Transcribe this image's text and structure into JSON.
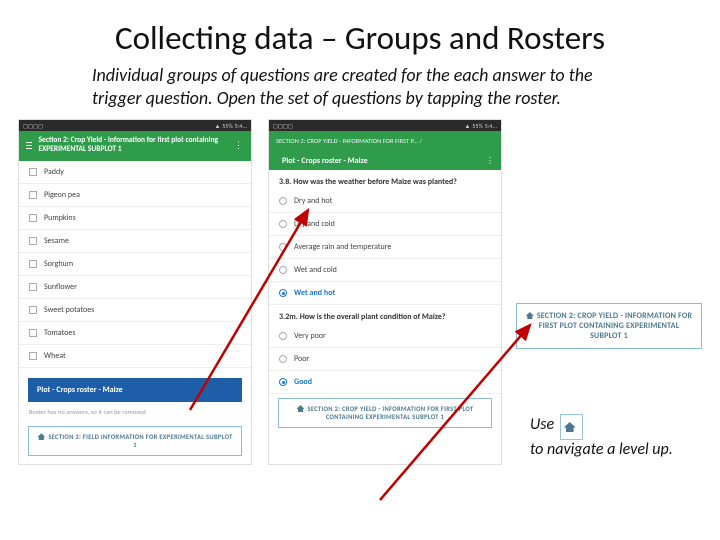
{
  "title": "Collecting data – Groups and Rosters",
  "subtitle": "Individual groups of questions are created for the each answer to the trigger question. Open the set of questions by tapping the roster.",
  "status": {
    "battery": "55%",
    "time": "5:4..."
  },
  "phone1": {
    "section": "Section 2: Crop Yield - Information for first plot containing EXPERIMENTAL SUBPLOT 1",
    "crops": [
      "Paddy",
      "Pigeon pea",
      "Pumpkins",
      "Sesame",
      "Sorghum",
      "Sunflower",
      "Sweet potatoes",
      "Tomatoes",
      "Wheat"
    ],
    "roster": "Plot - Crops roster - Maize",
    "hint": "Roster has no answers, so it can be removed",
    "nav": "SECTION 3: FIELD INFORMATION FOR EXPERIMENTAL SUBPLOT 1"
  },
  "phone2": {
    "section_top": "SECTION 2: CROP YIELD - INFORMATION FOR FIRST P... /",
    "section": "Plot - Crops roster - Maize",
    "q1": "3.8. How was the weather before Maize was planted?",
    "opts1": [
      {
        "label": "Dry and hot",
        "sel": false
      },
      {
        "label": "Dry and cold",
        "sel": false
      },
      {
        "label": "Average rain and temperature",
        "sel": false
      },
      {
        "label": "Wet and cold",
        "sel": false
      },
      {
        "label": "Wet and hot",
        "sel": true
      }
    ],
    "q2": "3.2m. How is the overall plant condition of Maize?",
    "opts2": [
      {
        "label": "Very poor",
        "sel": false
      },
      {
        "label": "Poor",
        "sel": false
      },
      {
        "label": "Good",
        "sel": true
      }
    ],
    "nav": "SECTION 2: CROP YIELD - INFORMATION FOR FIRST PLOT CONTAINING EXPERIMENTAL SUBPLOT 1"
  },
  "callout": "SECTION 2: CROP YIELD - INFORMATION FOR FIRST PLOT CONTAINING EXPERIMENTAL SUBPLOT 1",
  "use": {
    "l1": "Use",
    "l2": "to navigate a level up."
  }
}
